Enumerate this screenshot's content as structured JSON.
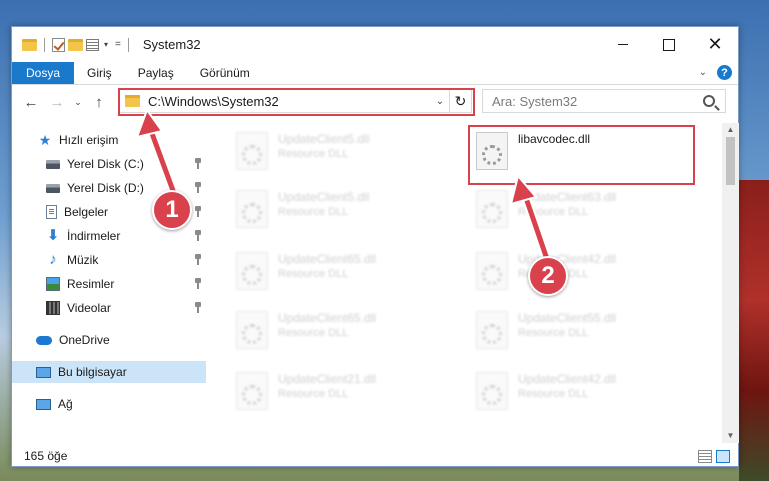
{
  "window": {
    "title": "System32",
    "quick_access": {
      "dropdown": "▾",
      "customize": "="
    }
  },
  "title_controls": {
    "minimize": "",
    "maximize": "",
    "close": "✕"
  },
  "ribbon": {
    "tabs": [
      {
        "label": "Dosya"
      },
      {
        "label": "Giriş"
      },
      {
        "label": "Paylaş"
      },
      {
        "label": "Görünüm"
      }
    ],
    "expand": "⌄",
    "help": "?"
  },
  "navigation": {
    "back": "←",
    "forward": "→",
    "recent": "⌄",
    "up": "↑",
    "address_path": "C:\\Windows\\System32",
    "address_dropdown": "⌄",
    "refresh": "↻",
    "search_placeholder": "Ara: System32"
  },
  "sidebar": {
    "quick_access": "Hızlı erişim",
    "items": [
      {
        "label": "Yerel Disk (C:)",
        "icon": "disk-icon"
      },
      {
        "label": "Yerel Disk (D:)",
        "icon": "disk-icon"
      },
      {
        "label": "Belgeler",
        "icon": "documents-icon"
      },
      {
        "label": "İndirmeler",
        "icon": "downloads-icon"
      },
      {
        "label": "Müzik",
        "icon": "music-icon"
      },
      {
        "label": "Resimler",
        "icon": "pictures-icon"
      },
      {
        "label": "Videolar",
        "icon": "videos-icon"
      }
    ],
    "onedrive": "OneDrive",
    "this_pc": "Bu bilgisayar",
    "network": "Ağ"
  },
  "files": {
    "highlighted": {
      "name": "libavcodec.dll"
    },
    "blurred": [
      {
        "name": "UpdateClient5.dll",
        "type": "Resource DLL"
      },
      {
        "name": "UpdateClient5.dll",
        "type": "Resource DLL"
      },
      {
        "name": "UpdateClient63.dll",
        "type": "Resource DLL"
      },
      {
        "name": "UpdateClient65.dll",
        "type": "Resource DLL"
      },
      {
        "name": "UpdateClient42.dll",
        "type": "Resource DLL"
      },
      {
        "name": "UpdateClient65.dll",
        "type": "Resource DLL"
      },
      {
        "name": "UpdateClient55.dll",
        "type": "Resource DLL"
      },
      {
        "name": "UpdateClient21.dll",
        "type": "Resource DLL"
      },
      {
        "name": "UpdateClient42.dll",
        "type": "Resource DLL"
      }
    ]
  },
  "scrollbar": {
    "up": "▲",
    "down": "▼"
  },
  "status": {
    "item_count": "165 öğe"
  },
  "callouts": {
    "step1": "1",
    "step2": "2"
  },
  "colors": {
    "accent": "#1979ca",
    "highlight": "#d9414d",
    "selection": "#cce4f7"
  }
}
